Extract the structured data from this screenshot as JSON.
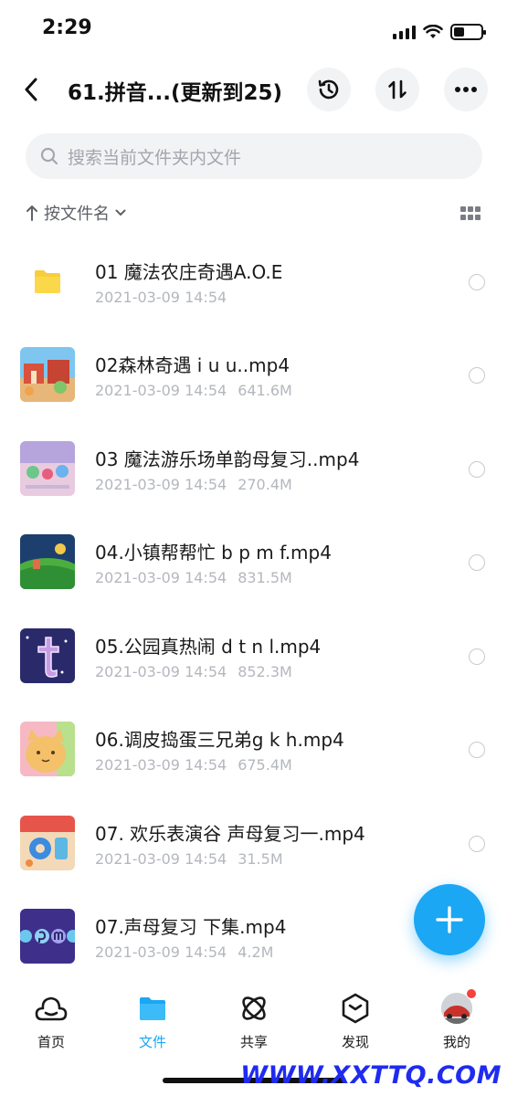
{
  "status": {
    "time": "2:29"
  },
  "header": {
    "title": "61.拼音...(更新到25)"
  },
  "search": {
    "placeholder": "搜索当前文件夹内文件"
  },
  "sort": {
    "label": "按文件名"
  },
  "files": [
    {
      "name": "01 魔法农庄奇遇A.O.E",
      "date": "2021-03-09 14:54",
      "size": "",
      "type": "folder"
    },
    {
      "name": "02森林奇遇 i u u..mp4",
      "date": "2021-03-09 14:54",
      "size": "641.6M",
      "type": "video"
    },
    {
      "name": "03 魔法游乐场单韵母复习..mp4",
      "date": "2021-03-09 14:54",
      "size": "270.4M",
      "type": "video"
    },
    {
      "name": "04.小镇帮帮忙 b p m f.mp4",
      "date": "2021-03-09 14:54",
      "size": "831.5M",
      "type": "video"
    },
    {
      "name": "05.公园真热闹 d t n l.mp4",
      "date": "2021-03-09 14:54",
      "size": "852.3M",
      "type": "video"
    },
    {
      "name": "06.调皮捣蛋三兄弟g k h.mp4",
      "date": "2021-03-09 14:54",
      "size": "675.4M",
      "type": "video"
    },
    {
      "name": "07. 欢乐表演谷 声母复习一.mp4",
      "date": "2021-03-09 14:54",
      "size": "31.5M",
      "type": "video"
    },
    {
      "name": "07.声母复习 下集.mp4",
      "date": "2021-03-09 14:54",
      "size": "4.2M",
      "type": "video"
    }
  ],
  "tabs": [
    {
      "label": "首页",
      "icon": "home-icon"
    },
    {
      "label": "文件",
      "icon": "folder-icon",
      "active": true
    },
    {
      "label": "共享",
      "icon": "share-atom-icon"
    },
    {
      "label": "发现",
      "icon": "discover-cube-icon"
    },
    {
      "label": "我的",
      "icon": "avatar"
    }
  ],
  "watermark": "WWW.XXTTQ.COM",
  "colors": {
    "accent": "#1ba7f4",
    "badge": "#f5423b"
  }
}
